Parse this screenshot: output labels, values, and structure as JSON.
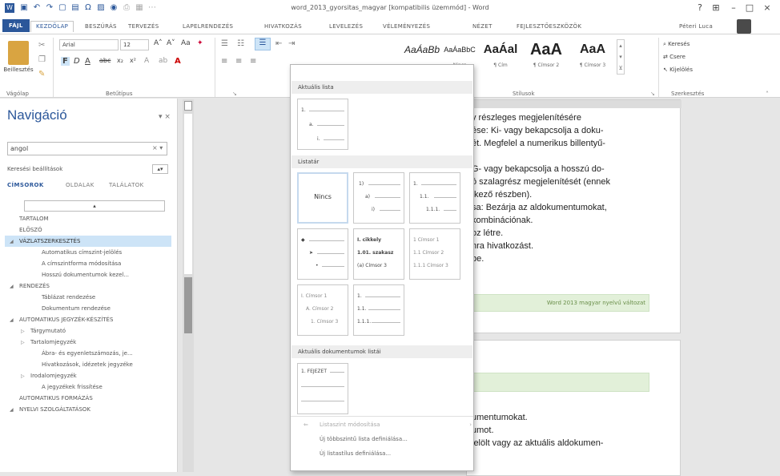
{
  "window": {
    "title": "word_2013_gyorsitas_magyar [kompatibilis üzemmód] - Word",
    "controls": [
      "?",
      "⊞",
      "–",
      "□",
      "×"
    ]
  },
  "tabs": {
    "file": "FÁJL",
    "items": [
      "KEZDŐLAP",
      "BESZÚRÁS",
      "TERVEZÉS",
      "LAPELRENDEZÉS",
      "HIVATKOZÁS",
      "LEVELEZÉS",
      "VÉLEMÉNYEZÉS",
      "NÉZET",
      "FEJLESZTŐESZKÖZÖK"
    ],
    "user": "Péteri Luca"
  },
  "ribbon": {
    "paste": "Beillesztés",
    "font_name": "Arial",
    "font_size": "12",
    "groups": {
      "clipboard": "Vágólap",
      "font": "Betűtípus",
      "styles": "Stílusok",
      "editing": "Szerkesztés"
    },
    "styles": [
      {
        "sample": "AaÁaBb",
        "name": "",
        "size": 12,
        "italic": true
      },
      {
        "sample": "AaÁaBbC",
        "name": "Nincs",
        "size": 9,
        "italic": false
      },
      {
        "sample": "AaÁal",
        "name": "¶ Cím",
        "size": 15,
        "italic": false
      },
      {
        "sample": "AaA",
        "name": "¶ Címsor 2",
        "size": 20,
        "italic": false
      },
      {
        "sample": "AaA",
        "name": "¶ Címsor 3",
        "size": 16,
        "italic": false
      }
    ],
    "styles_more": "Több",
    "editing": {
      "find": "Keresés",
      "replace": "Csere",
      "select": "Kijelölés"
    }
  },
  "nav": {
    "title": "Navigáció",
    "search_value": "angol",
    "search_suggestions": "Keresési beállítások",
    "tabs": [
      "CÍMSOROK",
      "OLDALAK",
      "TALÁLATOK"
    ],
    "items": [
      {
        "label": "TARTALOM",
        "level": 0,
        "arrow": ""
      },
      {
        "label": "ELŐSZÓ",
        "level": 0,
        "arrow": ""
      },
      {
        "label": "VÁZLATSZERKESZTÉS",
        "level": 0,
        "arrow": "◢",
        "selected": true
      },
      {
        "label": "Automatikus címszint-jelölés",
        "level": 2,
        "arrow": ""
      },
      {
        "label": "A címszintforma módosítása",
        "level": 2,
        "arrow": ""
      },
      {
        "label": "Hosszú dokumentumok kezel...",
        "level": 2,
        "arrow": ""
      },
      {
        "label": "RENDEZÉS",
        "level": 0,
        "arrow": "◢"
      },
      {
        "label": "Táblázat rendezése",
        "level": 2,
        "arrow": ""
      },
      {
        "label": "Dokumentum rendezése",
        "level": 2,
        "arrow": ""
      },
      {
        "label": "AUTOMATIKUS JEGYZÉK-KÉSZÍTÉS",
        "level": 0,
        "arrow": "◢"
      },
      {
        "label": "Tárgymutató",
        "level": 1,
        "arrow": "▷"
      },
      {
        "label": "Tartalomjegyzék",
        "level": 1,
        "arrow": "▷"
      },
      {
        "label": "Ábra- és egyenletszámozás, je...",
        "level": 2,
        "arrow": ""
      },
      {
        "label": "Hivatkozások, idézetek jegyzéke",
        "level": 2,
        "arrow": ""
      },
      {
        "label": "Irodalomjegyzék",
        "level": 1,
        "arrow": "▷"
      },
      {
        "label": "A jegyzékek frissítése",
        "level": 2,
        "arrow": ""
      },
      {
        "label": "AUTOMATIKUS FORMÁZÁS",
        "level": 0,
        "arrow": ""
      },
      {
        "label": "NYELVI SZOLGÁLTATÁSOK",
        "level": 0,
        "arrow": "◢"
      }
    ]
  },
  "dropdown": {
    "recent_header": "Aktuális lista",
    "library_header": "Listatár",
    "doc_header": "Aktuális dokumentumok listái",
    "none_label": "Nincs",
    "cells": {
      "recent": [
        "1.",
        "a.",
        "i."
      ],
      "lib_b1": [
        "1)",
        "a)",
        "i)"
      ],
      "lib_b2": [
        "1.",
        "1.1.",
        "1.1.1."
      ],
      "lib_c0": [
        "◆",
        "➤",
        "•"
      ],
      "lib_c1": [
        "I. cikkely",
        "1.01. szakasz",
        "(a) Címsor 3"
      ],
      "lib_c2": [
        "1 Címsor 1",
        "1.1 Címsor 2",
        "1.1.1 Címsor 3"
      ],
      "lib_d0": [
        "I. Címsor 1",
        "A. Címsor 2",
        "1. Címsor 3"
      ],
      "lib_d1": [
        "1.",
        "1.1.",
        "1.1.1."
      ],
      "doc": [
        "1. FEJEZET"
      ]
    },
    "menu": [
      {
        "label": "Listaszint módosítása",
        "disabled": true
      },
      {
        "label": "Új többszintű lista definiálása...",
        "disabled": false
      },
      {
        "label": "Új listastílus definiálása...",
        "disabled": false
      }
    ]
  },
  "document": {
    "page1_lines": [
      "y részleges megjelenítésére",
      "ése: Ki- vagy bekapcsolja a doku-",
      "ét. Megfelel a numerikus billentyű-",
      "",
      "G- vagy bekapcsolja a hosszú do-",
      "ó szalagrész megjelenítését (ennek",
      "tkező részben).",
      "sa: Bezárja az aldokumentumokat,",
      "kombinációnak.",
      "oz létre.",
      "nra hivatkozást.",
      "be."
    ],
    "footer": "Word 2013 magyar nyelvű változat",
    "page2_lines": [
      "umentumokat.",
      "umot.",
      "jelölt vagy az aktuális aldokumen-"
    ]
  }
}
